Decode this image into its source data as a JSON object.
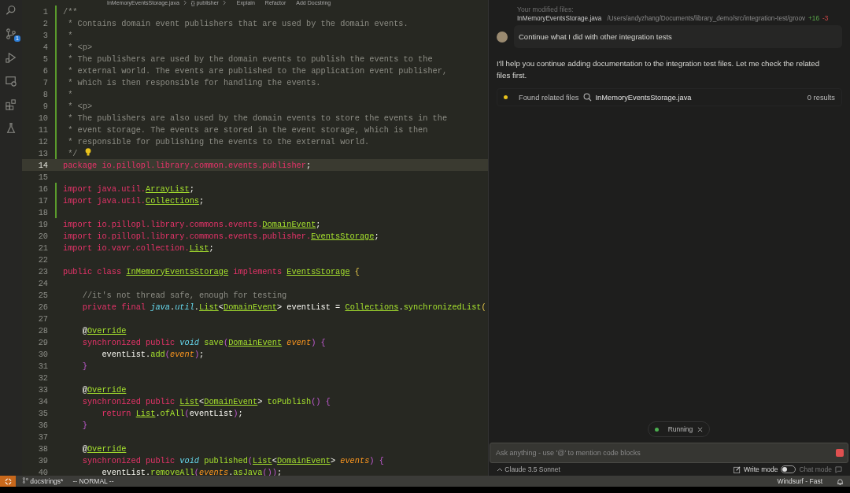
{
  "breadcrumb": {
    "items": [
      "InMemoryEventsStorage.java",
      "{} publisher"
    ],
    "actions": [
      "Explain",
      "Refactor",
      "Add Docstring"
    ]
  },
  "activity_bar": {
    "items": [
      {
        "kind": "search"
      },
      {
        "kind": "source-control",
        "badge": "1"
      },
      {
        "kind": "run"
      },
      {
        "kind": "remote"
      },
      {
        "kind": "extensions"
      },
      {
        "kind": "flask"
      }
    ]
  },
  "editor": {
    "lines": [
      {
        "number": "1",
        "current": false,
        "changed": true,
        "tokens": [
          {
            "kind": "c",
            "text": "/**"
          }
        ]
      },
      {
        "number": "2",
        "current": false,
        "changed": true,
        "tokens": [
          {
            "kind": "c",
            "text": " * Contains domain event publishers that are used by the domain events."
          }
        ]
      },
      {
        "number": "3",
        "current": false,
        "changed": true,
        "tokens": [
          {
            "kind": "c",
            "text": " *"
          }
        ]
      },
      {
        "number": "4",
        "current": false,
        "changed": true,
        "tokens": [
          {
            "kind": "c",
            "text": " * <p>"
          }
        ]
      },
      {
        "number": "5",
        "current": false,
        "changed": true,
        "tokens": [
          {
            "kind": "c",
            "text": " * The publishers are used by the domain events to publish the events to the"
          }
        ]
      },
      {
        "number": "6",
        "current": false,
        "changed": true,
        "tokens": [
          {
            "kind": "c",
            "text": " * external world. The events are published to the application event publisher,"
          }
        ]
      },
      {
        "number": "7",
        "current": false,
        "changed": true,
        "tokens": [
          {
            "kind": "c",
            "text": " * which is then responsible for handling the events."
          }
        ]
      },
      {
        "number": "8",
        "current": false,
        "changed": true,
        "tokens": [
          {
            "kind": "c",
            "text": " *"
          }
        ]
      },
      {
        "number": "9",
        "current": false,
        "changed": true,
        "tokens": [
          {
            "kind": "c",
            "text": " * <p>"
          }
        ]
      },
      {
        "number": "10",
        "current": false,
        "changed": true,
        "tokens": [
          {
            "kind": "c",
            "text": " * The publishers are also used by the domain events to store the events in the"
          }
        ]
      },
      {
        "number": "11",
        "current": false,
        "changed": true,
        "tokens": [
          {
            "kind": "c",
            "text": " * event storage. The events are stored in the event storage, which is then"
          }
        ]
      },
      {
        "number": "12",
        "current": false,
        "changed": true,
        "tokens": [
          {
            "kind": "c",
            "text": " * responsible for publishing the events to the external world."
          }
        ]
      },
      {
        "number": "13",
        "current": false,
        "changed": true,
        "bulb": true,
        "tokens": [
          {
            "kind": "c",
            "text": " */"
          }
        ]
      },
      {
        "number": "14",
        "current": true,
        "changed": false,
        "tokens": [
          {
            "kind": "k",
            "text": "package io.pillopl.library.common.events.publisher"
          },
          {
            "kind": "x",
            "text": ";"
          }
        ]
      },
      {
        "number": "15",
        "current": false,
        "changed": false
      },
      {
        "number": "16",
        "current": false,
        "changed": true,
        "tokens": [
          {
            "kind": "k",
            "text": "import java.util."
          },
          {
            "kind": "t",
            "text": "ArrayList"
          },
          {
            "kind": "x",
            "text": ";"
          }
        ]
      },
      {
        "number": "17",
        "current": false,
        "changed": true,
        "tokens": [
          {
            "kind": "k",
            "text": "import java.util."
          },
          {
            "kind": "t",
            "text": "Collections"
          },
          {
            "kind": "x",
            "text": ";"
          }
        ]
      },
      {
        "number": "18",
        "current": false,
        "changed": true
      },
      {
        "number": "19",
        "current": false,
        "changed": false,
        "tokens": [
          {
            "kind": "k",
            "text": "import io.pillopl.library.commons.events."
          },
          {
            "kind": "t",
            "text": "DomainEvent"
          },
          {
            "kind": "x",
            "text": ";"
          }
        ]
      },
      {
        "number": "20",
        "current": false,
        "changed": false,
        "tokens": [
          {
            "kind": "k",
            "text": "import io.pillopl.library.commons.events.publisher."
          },
          {
            "kind": "t",
            "text": "EventsStorage"
          },
          {
            "kind": "x",
            "text": ";"
          }
        ]
      },
      {
        "number": "21",
        "current": false,
        "changed": false,
        "tokens": [
          {
            "kind": "k",
            "text": "import io.vavr.collection."
          },
          {
            "kind": "t",
            "text": "List"
          },
          {
            "kind": "x",
            "text": ";"
          }
        ]
      },
      {
        "number": "22",
        "current": false,
        "changed": false
      },
      {
        "number": "23",
        "current": false,
        "changed": false,
        "tokens": [
          {
            "kind": "k",
            "text": "public class "
          },
          {
            "kind": "t",
            "text": "InMemoryEventsStorage"
          },
          {
            "kind": "k",
            "text": " implements "
          },
          {
            "kind": "t",
            "text": "EventsStorage"
          },
          {
            "kind": "b",
            "text": " {"
          }
        ]
      },
      {
        "number": "24",
        "current": false,
        "changed": false
      },
      {
        "number": "25",
        "current": false,
        "changed": false,
        "tokens": [
          {
            "kind": "c",
            "text": "    //it's not thread safe, enough for testing"
          }
        ]
      },
      {
        "number": "26",
        "current": false,
        "changed": false,
        "tokens": [
          {
            "kind": "k",
            "text": "    private final "
          },
          {
            "kind": "i",
            "text": "java"
          },
          {
            "kind": "x",
            "text": "."
          },
          {
            "kind": "i",
            "text": "util"
          },
          {
            "kind": "x",
            "text": "."
          },
          {
            "kind": "t",
            "text": "List"
          },
          {
            "kind": "x",
            "text": "<"
          },
          {
            "kind": "t",
            "text": "DomainEvent"
          },
          {
            "kind": "x",
            "text": "> eventList = "
          },
          {
            "kind": "t",
            "text": "Collections"
          },
          {
            "kind": "x",
            "text": "."
          },
          {
            "kind": "f",
            "text": "synchronizedList"
          },
          {
            "kind": "b",
            "text": "("
          }
        ]
      },
      {
        "number": "27",
        "current": false,
        "changed": false
      },
      {
        "number": "28",
        "current": false,
        "changed": false,
        "tokens": [
          {
            "kind": "x",
            "text": "    @"
          },
          {
            "kind": "t",
            "text": "Override"
          }
        ]
      },
      {
        "number": "29",
        "current": false,
        "changed": false,
        "tokens": [
          {
            "kind": "k",
            "text": "    synchronized public "
          },
          {
            "kind": "i",
            "text": "void"
          },
          {
            "kind": "f",
            "text": " save"
          },
          {
            "kind": "m",
            "text": "("
          },
          {
            "kind": "t",
            "text": "DomainEvent"
          },
          {
            "kind": "p",
            "text": " event"
          },
          {
            "kind": "m",
            "text": ") {"
          }
        ]
      },
      {
        "number": "30",
        "current": false,
        "changed": false,
        "tokens": [
          {
            "kind": "x",
            "text": "        eventList."
          },
          {
            "kind": "f",
            "text": "add"
          },
          {
            "kind": "m",
            "text": "("
          },
          {
            "kind": "p",
            "text": "event"
          },
          {
            "kind": "m",
            "text": ")"
          },
          {
            "kind": "x",
            "text": ";"
          }
        ]
      },
      {
        "number": "31",
        "current": false,
        "changed": false,
        "tokens": [
          {
            "kind": "m",
            "text": "    }"
          }
        ]
      },
      {
        "number": "32",
        "current": false,
        "changed": false
      },
      {
        "number": "33",
        "current": false,
        "changed": false,
        "tokens": [
          {
            "kind": "x",
            "text": "    @"
          },
          {
            "kind": "t",
            "text": "Override"
          }
        ]
      },
      {
        "number": "34",
        "current": false,
        "changed": false,
        "tokens": [
          {
            "kind": "k",
            "text": "    synchronized public "
          },
          {
            "kind": "t",
            "text": "List"
          },
          {
            "kind": "x",
            "text": "<"
          },
          {
            "kind": "t",
            "text": "DomainEvent"
          },
          {
            "kind": "x",
            "text": "> "
          },
          {
            "kind": "f",
            "text": "toPublish"
          },
          {
            "kind": "m",
            "text": "() {"
          }
        ]
      },
      {
        "number": "35",
        "current": false,
        "changed": false,
        "tokens": [
          {
            "kind": "k",
            "text": "        return "
          },
          {
            "kind": "t",
            "text": "List"
          },
          {
            "kind": "x",
            "text": "."
          },
          {
            "kind": "f",
            "text": "ofAll"
          },
          {
            "kind": "m",
            "text": "("
          },
          {
            "kind": "x",
            "text": "eventList"
          },
          {
            "kind": "m",
            "text": ")"
          },
          {
            "kind": "x",
            "text": ";"
          }
        ]
      },
      {
        "number": "36",
        "current": false,
        "changed": false,
        "tokens": [
          {
            "kind": "m",
            "text": "    }"
          }
        ]
      },
      {
        "number": "37",
        "current": false,
        "changed": false
      },
      {
        "number": "38",
        "current": false,
        "changed": false,
        "tokens": [
          {
            "kind": "x",
            "text": "    @"
          },
          {
            "kind": "t",
            "text": "Override"
          }
        ]
      },
      {
        "number": "39",
        "current": false,
        "changed": false,
        "tokens": [
          {
            "kind": "k",
            "text": "    synchronized public "
          },
          {
            "kind": "i",
            "text": "void"
          },
          {
            "kind": "f",
            "text": " published"
          },
          {
            "kind": "m",
            "text": "("
          },
          {
            "kind": "t",
            "text": "List"
          },
          {
            "kind": "x",
            "text": "<"
          },
          {
            "kind": "t",
            "text": "DomainEvent"
          },
          {
            "kind": "x",
            "text": "> "
          },
          {
            "kind": "p",
            "text": "events"
          },
          {
            "kind": "m",
            "text": ") {"
          }
        ]
      },
      {
        "number": "40",
        "current": false,
        "changed": false,
        "tokens": [
          {
            "kind": "x",
            "text": "        eventList."
          },
          {
            "kind": "f",
            "text": "removeAll"
          },
          {
            "kind": "m",
            "text": "("
          },
          {
            "kind": "p",
            "text": "events"
          },
          {
            "kind": "x",
            "text": "."
          },
          {
            "kind": "f",
            "text": "asJava"
          },
          {
            "kind": "m",
            "text": "())"
          },
          {
            "kind": "x",
            "text": ";"
          }
        ]
      }
    ]
  },
  "chat": {
    "modified_files": {
      "label": "Your modified files:",
      "files": [
        {
          "name": "InMemoryEventsStorage.java",
          "path": "/Users/andyzhang/Documents/library_demo/src/integration-test/groov",
          "added": "+16",
          "removed": "-3"
        }
      ]
    },
    "user_message": "Continue what I did with other integration tests",
    "assistant_message": "I'll help you continue adding documentation to the integration test files. Let me check the related files first.",
    "tool_step": {
      "in_progress": true,
      "label": "Found related files",
      "query": "InMemoryEventsStorage.java",
      "result": "0 results"
    },
    "running_pill": {
      "label": "Running"
    },
    "input": {
      "placeholder": "Ask anything - use '@' to mention code blocks"
    },
    "model": "Claude 3.5 Sonnet",
    "modes": {
      "write_label": "Write mode",
      "chat_label": "Chat mode",
      "chat_mode": false
    }
  },
  "status_bar": {
    "branch": "docstrings*",
    "mode": "-- NORMAL --",
    "right": "Windsurf - Fast"
  }
}
